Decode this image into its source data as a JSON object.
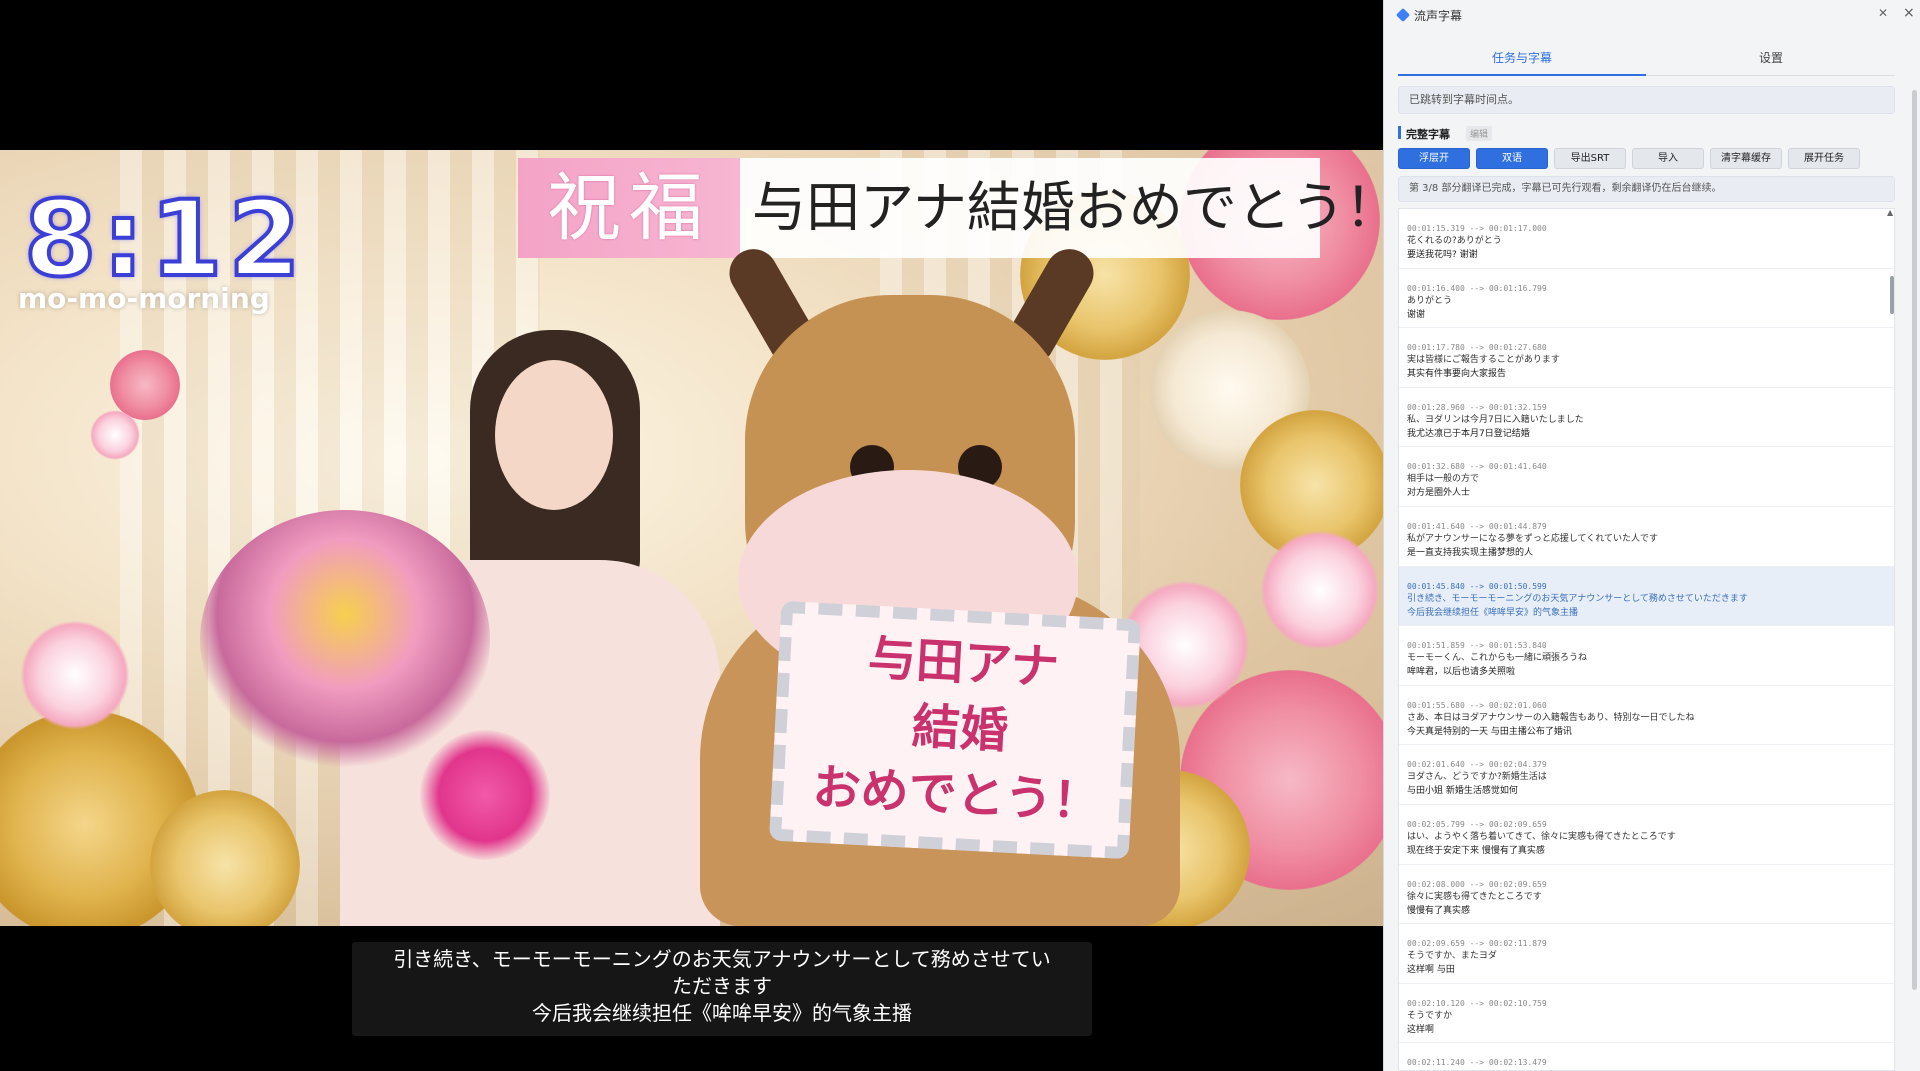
{
  "video": {
    "clock": "8:12",
    "brand": "mo-mo-morning",
    "banner_left": "祝福",
    "banner_right": "与田アナ結婚おめでとう！",
    "sign_text": [
      "与田アナ",
      "結婚",
      "おめでとう！"
    ],
    "subtitle_lines": [
      "引き続き、モーモーモーニングのお天気アナウンサーとして務めさせてい",
      "ただきます",
      "今后我会继续担任《哞哞早安》的气象主播"
    ]
  },
  "panel": {
    "title": "流声字幕",
    "tabs": [
      {
        "label": "任务与字幕",
        "active": true
      },
      {
        "label": "设置",
        "active": false
      }
    ],
    "notice": "已跳转到字幕时间点。",
    "section_title": "完整字幕",
    "section_tag": "编辑",
    "buttons": [
      {
        "label": "浮层开",
        "primary": true
      },
      {
        "label": "双语",
        "primary": true
      },
      {
        "label": "导出SRT",
        "primary": false
      },
      {
        "label": "导入",
        "primary": false
      },
      {
        "label": "清字幕缓存",
        "primary": false
      },
      {
        "label": "展开任务",
        "primary": false
      }
    ],
    "progress": "第 3/8 部分翻译已完成，字幕已可先行观看，剩余翻译仍在后台继续。",
    "entries": [
      {
        "time": "00:01:15.319 --> 00:01:17.000",
        "ja": "花くれるの?ありがとう",
        "zh": "要送我花吗? 谢谢",
        "active": false
      },
      {
        "time": "00:01:16.400 --> 00:01:16.799",
        "ja": "ありがとう",
        "zh": "谢谢",
        "active": false
      },
      {
        "time": "00:01:17.780 --> 00:01:27.680",
        "ja": "実は皆様にご報告することがあります",
        "zh": "其实有件事要向大家报告",
        "active": false
      },
      {
        "time": "00:01:28.960 --> 00:01:32.159",
        "ja": "私、ヨダリンは今月7日に入籍いたしました",
        "zh": "我尤达凛已于本月7日登记结婚",
        "active": false
      },
      {
        "time": "00:01:32.680 --> 00:01:41.640",
        "ja": "相手は一般の方で",
        "zh": "对方是圈外人士",
        "active": false
      },
      {
        "time": "00:01:41.640 --> 00:01:44.879",
        "ja": "私がアナウンサーになる夢をずっと応援してくれていた人です",
        "zh": "是一直支持我实现主播梦想的人",
        "active": false
      },
      {
        "time": "00:01:45.840 --> 00:01:50.599",
        "ja": "引き続き、モーモーモーニングのお天気アナウンサーとして務めさせていただきます",
        "zh": "今后我会继续担任《哞哞早安》的气象主播",
        "active": true
      },
      {
        "time": "00:01:51.859 --> 00:01:53.840",
        "ja": "モーモーくん、これからも一緒に頑張ろうね",
        "zh": "哞哞君，以后也请多关照啦",
        "active": false
      },
      {
        "time": "00:01:55.680 --> 00:02:01.060",
        "ja": "さあ、本日はヨダアナウンサーの入籍報告もあり、特別な一日でしたね",
        "zh": "今天真是特别的一天 与田主播公布了婚讯",
        "active": false
      },
      {
        "time": "00:02:01.640 --> 00:02:04.379",
        "ja": "ヨダさん、どうですか?新婚生活は",
        "zh": "与田小姐 新婚生活感觉如何",
        "active": false
      },
      {
        "time": "00:02:05.799 --> 00:02:09.659",
        "ja": "はい、ようやく落ち着いてきて、徐々に実感も得てきたところです",
        "zh": "现在终于安定下来 慢慢有了真实感",
        "active": false
      },
      {
        "time": "00:02:08.000 --> 00:02:09.659",
        "ja": "徐々に実感も得てきたところです",
        "zh": "慢慢有了真实感",
        "active": false
      },
      {
        "time": "00:02:09.659 --> 00:02:11.879",
        "ja": "そうですか、またヨダ",
        "zh": "这样啊 与田",
        "active": false
      },
      {
        "time": "00:02:10.120 --> 00:02:10.759",
        "ja": "そうですか",
        "zh": "这样啊",
        "active": false
      },
      {
        "time": "00:02:11.240 --> 00:02:13.479",
        "ja": "",
        "zh": "",
        "active": false
      }
    ]
  }
}
